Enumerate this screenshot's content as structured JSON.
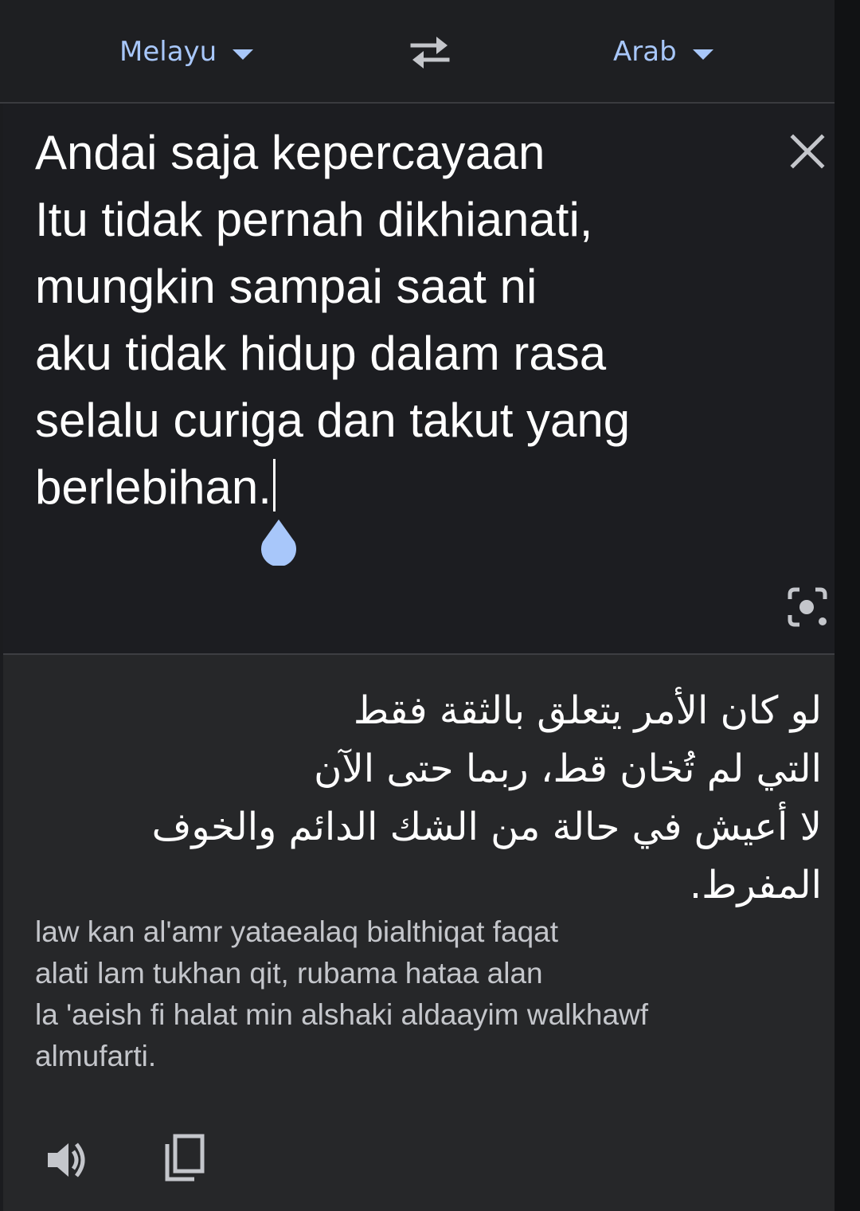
{
  "language_bar": {
    "source_language": "Melayu",
    "target_language": "Arab",
    "swap_icon": "swap-arrows-icon"
  },
  "source": {
    "text": "Andai saja kepercayaan\nItu tidak pernah dikhianati,\nmungkin sampai saat ni\naku tidak hidup dalam rasa\nselalu curiga dan takut yang\nberlebihan.",
    "clear_icon": "close-icon",
    "camera_icon": "lens-camera-icon"
  },
  "result": {
    "translation": "لو كان الأمر يتعلق بالثقة فقط\nالتي لم تُخان قط، ربما حتى الآن\nلا أعيش في حالة من الشك الدائم والخوف\nالمفرط.",
    "transliteration": "law kan al'amr yataealaq bialthiqat faqat\nalati lam tukhan qit, rubama hataa alan\nla 'aeish fi halat min alshaki aldaayim walkhawf\nalmufarti.",
    "speak_icon": "speaker-icon",
    "copy_icon": "copy-icon"
  },
  "colors": {
    "accent": "#a8c7fa",
    "background": "#1b1c1f",
    "result_background": "#262729",
    "text_primary": "#ffffff",
    "text_secondary": "#c4c6cb"
  }
}
